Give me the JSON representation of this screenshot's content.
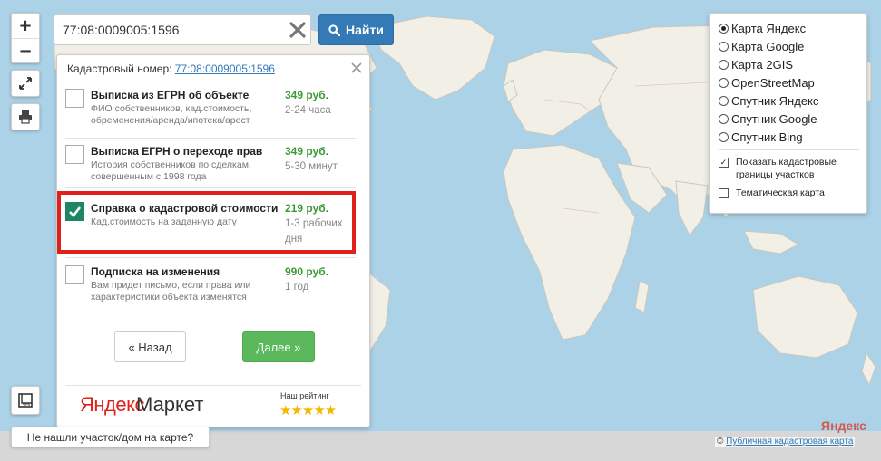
{
  "search": {
    "value": "77:08:0009005:1596",
    "button_label": "Найти"
  },
  "zoom": {
    "plus": "+",
    "minus": "−"
  },
  "panel": {
    "header_label": "Кадастровый номер:",
    "header_link": "77:08:0009005:1596",
    "options": [
      {
        "title": "Выписка из ЕГРН об объекте",
        "description": "ФИО собственников, кад.стоимость, обременения/аренда/ипотека/арест",
        "price": "349 руб.",
        "time": "2-24 часа",
        "checked": false
      },
      {
        "title": "Выписка ЕГРН о переходе прав",
        "description": "История собственников по сделкам, совершенным с 1998 года",
        "price": "349 руб.",
        "time": "5-30 минут",
        "checked": false
      },
      {
        "title": "Справка о кадастровой стоимости",
        "description": "Кад.стоимость на заданную дату",
        "price": "219 руб.",
        "time": "1-3 рабочих дня",
        "checked": true
      },
      {
        "title": "Подписка на изменения",
        "description": "Вам придет письмо, если права или характеристики объекта изменятся",
        "price": "990 руб.",
        "time": "1 год",
        "checked": false
      }
    ],
    "back_label": "« Назад",
    "next_label": "Далее »",
    "market_logo_a": "Яндекс",
    "market_logo_b": "Маркет",
    "rating_label": "Наш рейтинг",
    "rating_stars": "★★★★★",
    "rating_value": 5
  },
  "layers": {
    "options": [
      {
        "label": "Карта Яндекс",
        "selected": true
      },
      {
        "label": "Карта Google",
        "selected": false
      },
      {
        "label": "Карта 2GIS",
        "selected": false
      },
      {
        "label": "OpenStreetMap",
        "selected": false
      },
      {
        "label": "Спутник Яндекс",
        "selected": false
      },
      {
        "label": "Спутник Google",
        "selected": false
      },
      {
        "label": "Спутник Bing",
        "selected": false
      }
    ],
    "show_boundaries_label": "Показать кадастровые границы участков",
    "show_boundaries_checked": true,
    "thematic_label": "Тематическая карта",
    "thematic_checked": false
  },
  "bottom_link": "Не нашли участок/дом на карте?",
  "copyright_symbol": "©",
  "copyright_link": "Публичная кадастровая карта",
  "watermark": "Яндекс",
  "colors": {
    "ocean": "#acd2e8",
    "land": "#f1efe6",
    "primary_button": "#337ab7",
    "next_button": "#5cb85c",
    "checked_box": "#1d8662",
    "highlight": "#e0201b",
    "price": "#3c9a35"
  }
}
